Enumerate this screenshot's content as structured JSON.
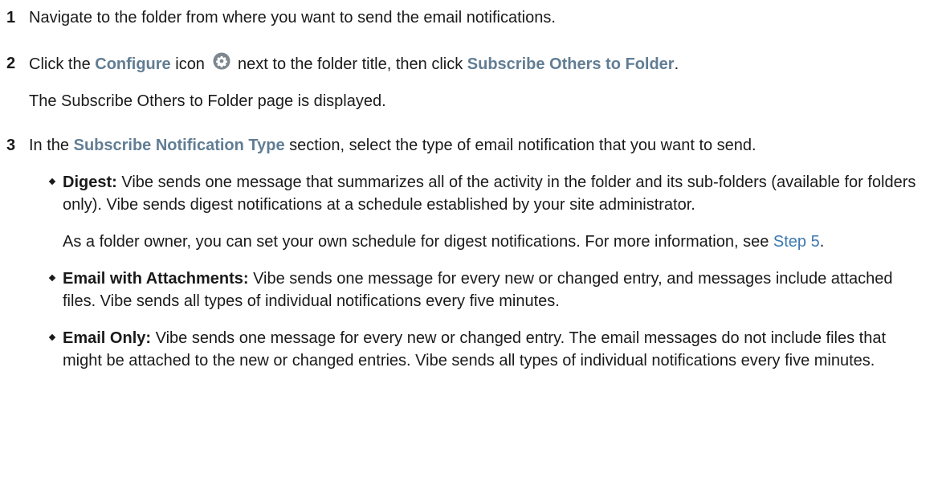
{
  "steps": [
    {
      "num": "1",
      "text": "Navigate to the folder from where you want to send the email notifications."
    },
    {
      "num": "2",
      "pre": "Click the ",
      "ui1": "Configure",
      "mid1": " icon ",
      "mid2": " next to the folder title, then click ",
      "ui2": "Subscribe Others to Folder",
      "post": ".",
      "result": "The Subscribe Others to Folder page is displayed."
    },
    {
      "num": "3",
      "pre": "In the ",
      "ui1": "Subscribe Notification Type",
      "post": " section, select the type of email notification that you want to send.",
      "bullets": [
        {
          "term": "Digest:",
          "text": " Vibe sends one message that summarizes all of the activity in the folder and its sub-folders (available for folders only). Vibe sends digest notifications at a schedule established by your site administrator.",
          "extra_pre": "As a folder owner, you can set your own schedule for digest notifications. For more information, see ",
          "extra_link": "Step 5",
          "extra_post": "."
        },
        {
          "term": "Email with Attachments:",
          "text": " Vibe sends one message for every new or changed entry, and messages include attached files. Vibe sends all types of individual notifications every five minutes."
        },
        {
          "term": "Email Only:",
          "text": " Vibe sends one message for every new or changed entry. The email messages do not include files that might be attached to the new or changed entries. Vibe sends all types of individual notifications every five minutes."
        }
      ]
    }
  ],
  "colors": {
    "ui_term": "#617d94",
    "link": "#3b78b0",
    "text": "#1a1a1a",
    "gear": "#7d8790"
  },
  "icons": {
    "configure": "gear-icon"
  }
}
